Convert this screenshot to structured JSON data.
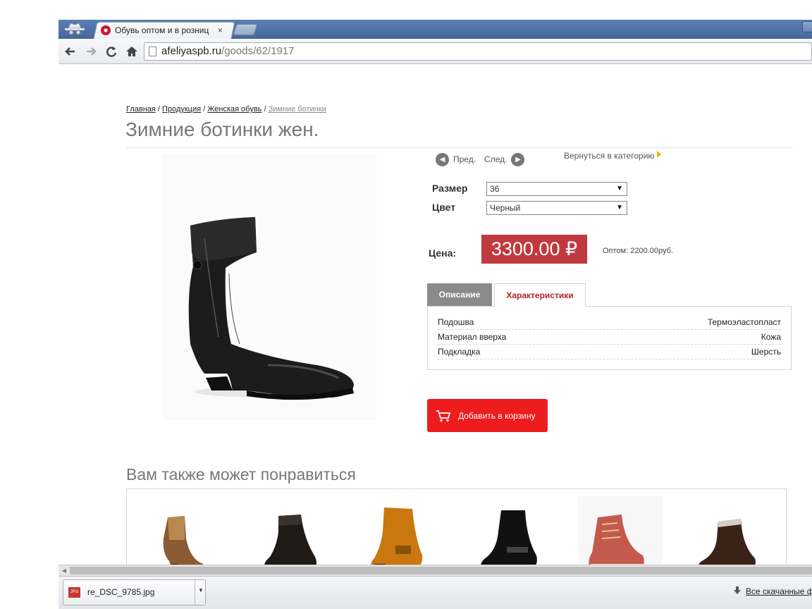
{
  "browser": {
    "tab_title": "Обувь оптом и в розниц",
    "tab_close": "×",
    "url_host": "afeliyaspb.ru",
    "url_path": "/goods/62/1917"
  },
  "breadcrumb": {
    "home": "Главная",
    "products": "Продукция",
    "women": "Женская обувь",
    "current": "Зимние ботинки",
    "sep": " / "
  },
  "product": {
    "title": "Зимние ботинки жен.",
    "prev": "Пред.",
    "next": "След.",
    "back_to_category": "Вернуться в категорию",
    "size_label": "Размер",
    "size_value": "36",
    "color_label": "Цвет",
    "color_value": "Черный",
    "price_label": "Цена:",
    "price": "3300.00 ₽",
    "wholesale": "Оптом: 2200.00руб.",
    "tab_description": "Описание",
    "tab_characteristics": "Характеристики",
    "characteristics": [
      {
        "name": "Подошва",
        "value": "Термоэластопласт"
      },
      {
        "name": "Материал вверха",
        "value": "Кожа"
      },
      {
        "name": "Подкладка",
        "value": "Шерсть"
      }
    ],
    "add_to_cart": "Добавить в корзину"
  },
  "related": {
    "title": "Вам также может понравиться"
  },
  "downloads": {
    "file_name": "re_DSC_9785.jpg",
    "file_type": "JPG",
    "all_downloads": "Все скачанные ф"
  },
  "colors": {
    "price_bg": "#c0393e",
    "cart_button": "#ee1c1c",
    "active_tab_text": "#b3252b",
    "chrome_frame": "#5b7fb5"
  }
}
